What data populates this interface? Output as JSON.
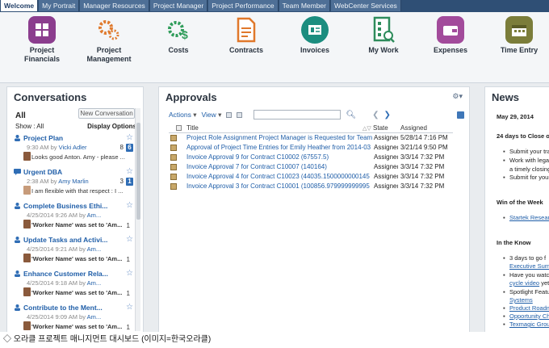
{
  "tabs": [
    "Welcome",
    "My Portrait",
    "Manager Resources",
    "Project Manager",
    "Project Performance",
    "Team Member",
    "WebCenter Services"
  ],
  "apps": [
    {
      "label": "Project\nFinancials",
      "color": "#8b3d8e",
      "icon": "financials-icon"
    },
    {
      "label": "Project\nManagement",
      "color": "#e07b2f",
      "icon": "gears-icon"
    },
    {
      "label": "Costs",
      "color": "#2f9c5a",
      "icon": "gear-dollar-icon"
    },
    {
      "label": "Contracts",
      "color": "#e0782b",
      "icon": "contract-icon"
    },
    {
      "label": "Invoices",
      "color": "#1b8d7f",
      "icon": "invoice-icon"
    },
    {
      "label": "My Work",
      "color": "#2e8c5c",
      "icon": "work-icon"
    },
    {
      "label": "Expenses",
      "color": "#a24b9b",
      "icon": "wallet-icon"
    },
    {
      "label": "Time Entry",
      "color": "#7b7d3a",
      "icon": "calendar-icon"
    }
  ],
  "conversations": {
    "title": "Conversations",
    "all": "All",
    "new_button": "New Conversation",
    "show_label": "Show : All",
    "display_options": "Display Options",
    "items": [
      {
        "title": "Project Plan",
        "time": "9:30 AM by",
        "user": "Vicki Adler",
        "msg": "Looks good Anton. Amy - please ...",
        "count": "8",
        "badge": "6",
        "glyph": "people"
      },
      {
        "title": "Urgent DBA",
        "time": "2:38 AM by",
        "user": "Amy Marlin",
        "msg": "I am flexible with that respect : I ...",
        "count": "3",
        "badge": "1",
        "glyph": "chat"
      },
      {
        "title": "Complete Business Ethi...",
        "time": "4/25/2014 9:26 AM by",
        "user": "Am...",
        "msg": "'Worker Name' was set to 'Am...",
        "count": "1",
        "badge": "",
        "glyph": "people"
      },
      {
        "title": "Update Tasks and Activi...",
        "time": "4/25/2014 9:21 AM by",
        "user": "Am...",
        "msg": "'Worker Name' was set to 'Am...",
        "count": "1",
        "badge": "",
        "glyph": "people"
      },
      {
        "title": "Enhance Customer Rela...",
        "time": "4/25/2014 9:18 AM by",
        "user": "Am...",
        "msg": "'Worker Name' was set to 'Am...",
        "count": "1",
        "badge": "",
        "glyph": "people"
      },
      {
        "title": "Contribute to the Ment...",
        "time": "4/25/2014 9:09 AM by",
        "user": "Am...",
        "msg": "'Worker Name' was set to 'Am...",
        "count": "1",
        "badge": "",
        "glyph": "people"
      }
    ]
  },
  "approvals": {
    "title": "Approvals",
    "actions": "Actions",
    "view": "View",
    "columns": [
      "Title",
      "State",
      "Assigned"
    ],
    "rows": [
      {
        "title": "Project Role Assignment Project Manager is Requested for Team",
        "state": "Assigned",
        "assigned": "5/28/14 7:16 PM"
      },
      {
        "title": "Approval of Project Time Entries for Emily Heather from 2014-03",
        "state": "Assigned",
        "assigned": "3/21/14 9:50 PM"
      },
      {
        "title": "Invoice Approval 9 for Contract C10002 (67557.5)",
        "state": "Assigned",
        "assigned": "3/3/14 7:32 PM"
      },
      {
        "title": "Invoice Approval 7 for Contract C10007 (140164)",
        "state": "Assigned",
        "assigned": "3/3/14 7:32 PM"
      },
      {
        "title": "Invoice Approval 4 for Contract C10023 (44035.1500000000145",
        "state": "Assigned",
        "assigned": "3/3/14 7:32 PM"
      },
      {
        "title": "Invoice Approval 3 for Contract C10001 (100856.979999999995",
        "state": "Assigned",
        "assigned": "3/3/14 7:32 PM"
      }
    ]
  },
  "news": {
    "title": "News",
    "date": "May 29, 2014",
    "headline1": "24 days to Close o",
    "b1": "Submit your tra",
    "b2": "Work with legal",
    "b3": "a timely closing",
    "b4": "Submit for your",
    "headline2": "Win of the Week",
    "link1": "Startek Researc",
    "headline3": "In the Know",
    "k1": "3 days to go f",
    "k1l": "Executive Sum",
    "k2": "Have you watch",
    "k2l": "cycle video",
    "k2t": " yet?",
    "k3": "Spotlight Featur",
    "k3l": "Systems",
    "k4": "Product Roadm",
    "k5": "Opportunity Ch",
    "k6": "Texmagic Grou"
  },
  "caption": "◇ 오라클 프로젝트 매니지먼트 대시보드 (이미지=한국오라클)"
}
